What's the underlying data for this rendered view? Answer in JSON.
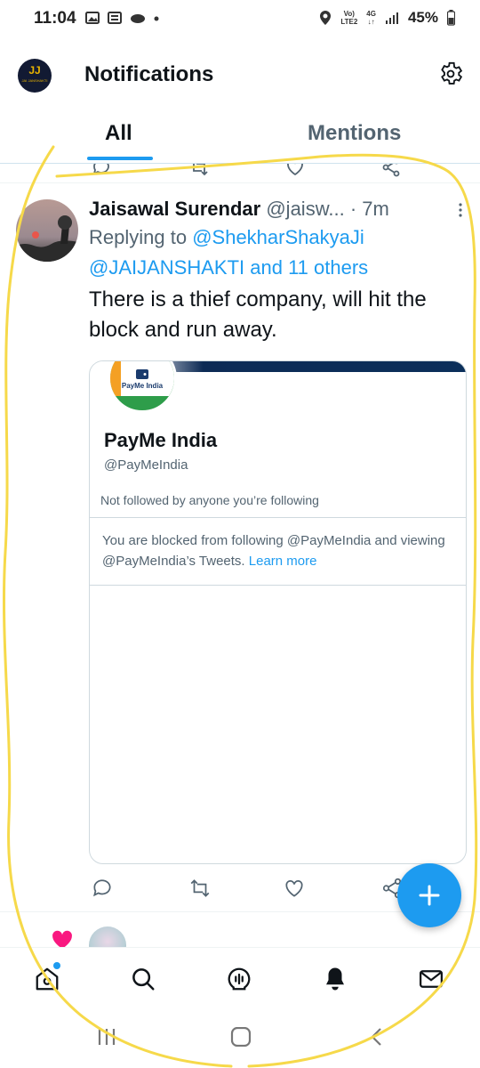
{
  "status_bar": {
    "time": "11:04",
    "network_top": "Vo)",
    "network_bottom": "LTE2",
    "network_4g": "4G",
    "battery": "45%"
  },
  "header": {
    "logo_text": "JJ",
    "logo_subtext": "JAI JANSHAKTI",
    "title": "Notifications",
    "settings_icon": "gear-icon"
  },
  "tabs": [
    {
      "label": "All",
      "selected": true
    },
    {
      "label": "Mentions",
      "selected": false
    }
  ],
  "tweet": {
    "name": "Jaisawal Surendar",
    "handle": "@jaisw...",
    "separator": "·",
    "time": "7m",
    "replying_prefix": "Replying to",
    "replying_to_1": "@ShekharShakyaJi",
    "replying_to_2": "@JAIJANSHAKTI and 11 others",
    "text": "There is a thief company, will hit the block and run away."
  },
  "card": {
    "logo_text": "PayMe India",
    "name": "PayMe India",
    "handle": "@PayMeIndia",
    "followed_by": "Not followed by anyone you’re following",
    "blocked_text": "You are blocked from following @PayMeIndia and viewing @PayMeIndia’s Tweets.",
    "learn_more": "Learn more"
  },
  "actions": [
    "reply-icon",
    "retweet-icon",
    "like-icon",
    "share-icon"
  ],
  "fab": {
    "icon": "plus-icon"
  },
  "bottom_nav": [
    "home-icon",
    "search-icon",
    "spaces-icon",
    "notifications-icon",
    "messages-icon"
  ],
  "system_nav": [
    "recents-icon",
    "home-circle-icon",
    "back-icon"
  ],
  "colors": {
    "accent": "#1d9bf0",
    "text": "#0f1419",
    "secondary": "#536471",
    "highlighter": "#f6d94a",
    "like_pink": "#f91880"
  }
}
